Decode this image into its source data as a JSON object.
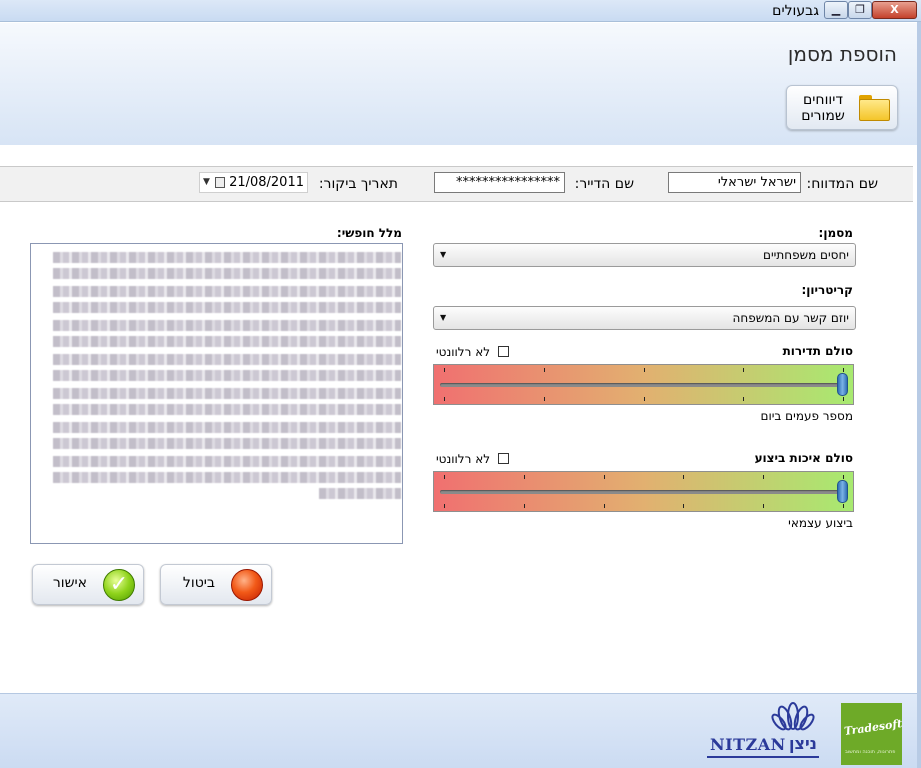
{
  "window": {
    "title": "גבעולים",
    "minimize_icon": "minimize-icon",
    "maximize_icon": "maximize-icon",
    "close_label": "X"
  },
  "header": {
    "page_title": "הוספת מסמן",
    "saved_reports_label": "דיווחים שמורים",
    "saved_reports_icon": "folder-icon"
  },
  "info": {
    "reporter_label": "שם המדווח:",
    "reporter_value": "ישראל ישראלי",
    "resident_label": "שם הדייר:",
    "resident_value": "****************",
    "visit_date_label": "תאריך ביקור:",
    "visit_date_value": "21/08/2011"
  },
  "free_text": {
    "label": "מלל חופשי:"
  },
  "marker": {
    "label": "מסמן:",
    "selected": "יחסים משפחתיים"
  },
  "criterion": {
    "label": "קריטריון:",
    "selected": "יוזם קשר עם המשפחה"
  },
  "frequency_scale": {
    "label": "סולם תדירות",
    "not_relevant_label": "לא רלוונטי",
    "not_relevant_checked": false,
    "caption": "מספר פעמים ביום",
    "value_fraction": 1.0,
    "tick_count": 5
  },
  "quality_scale": {
    "label": "סולם איכות ביצוע",
    "not_relevant_label": "לא רלוונטי",
    "not_relevant_checked": false,
    "caption": "ביצוע עצמאי",
    "value_fraction": 1.0,
    "tick_count": 6
  },
  "actions": {
    "cancel_label": "ביטול",
    "confirm_label": "אישור",
    "confirm_glyph": "✓"
  },
  "footer": {
    "nitzan_word": "NITZAN",
    "nitzan_hebrew": "ניצן",
    "tradesoft_word": "Tradesoft",
    "tradesoft_tagline": "פתרונות, תוכנה ומחשוב"
  },
  "colors": {
    "slider_low": "#f07070",
    "slider_high": "#a7ea70",
    "thumb": "#2f6fb5",
    "nitzan_blue": "#2b3a9a",
    "tradesoft_green": "#6eaa28"
  }
}
